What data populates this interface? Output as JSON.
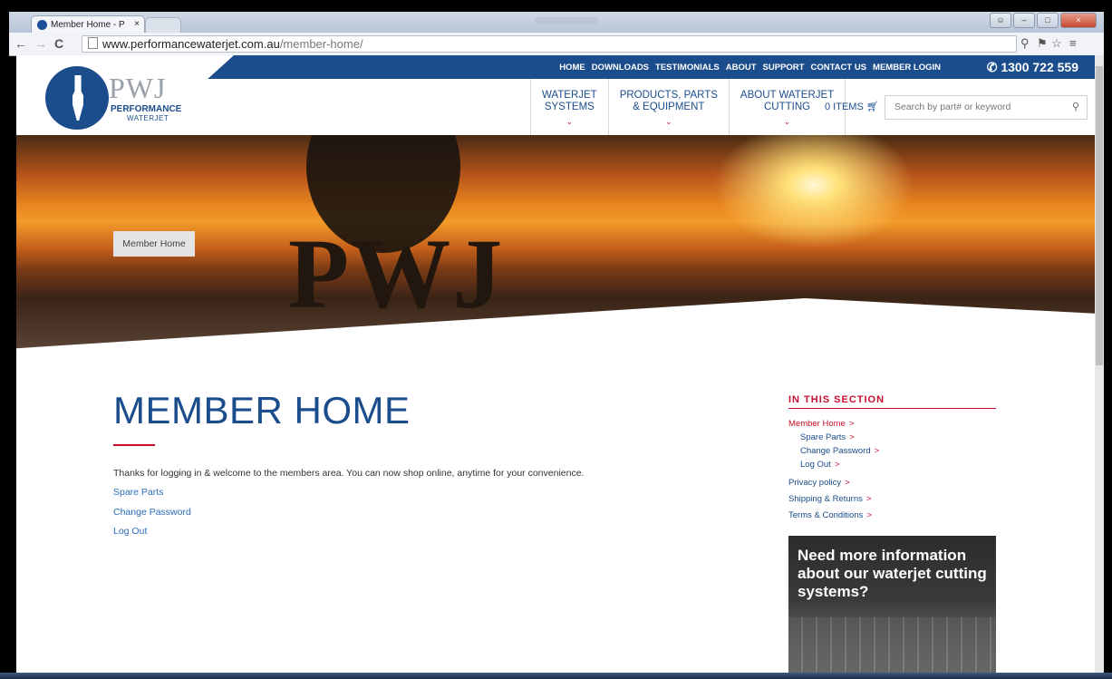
{
  "browser": {
    "tab_title": "Member Home - Perform",
    "tab_close": "×",
    "url_domain": "www.performancewaterjet.com.au",
    "url_path": "/member-home/"
  },
  "topbar": {
    "links": [
      "HOME",
      "DOWNLOADS",
      "TESTIMONIALS",
      "ABOUT",
      "SUPPORT",
      "CONTACT US",
      "MEMBER LOGIN"
    ],
    "phone": "1300 722 559"
  },
  "logo": {
    "mark": "PWJ",
    "line1": "PERFORMANCE",
    "line2": "WATERJET"
  },
  "nav": {
    "items": [
      {
        "line1": "WATERJET",
        "line2": "SYSTEMS"
      },
      {
        "line1": "PRODUCTS, PARTS",
        "line2": "& EQUIPMENT"
      },
      {
        "line1": "ABOUT WATERJET",
        "line2": "CUTTING"
      }
    ],
    "cart": "0 ITEMS",
    "search_placeholder": "Search by part# or keyword"
  },
  "hero": {
    "breadcrumb": "Member Home"
  },
  "main": {
    "title": "MEMBER HOME",
    "intro": "Thanks for logging in & welcome to the members area. You can now shop online, anytime for your convenience.",
    "links": [
      "Spare Parts",
      "Change Password",
      "Log Out"
    ]
  },
  "sidebar": {
    "title": "IN THIS SECTION",
    "active": "Member Home",
    "sub": [
      "Spare Parts",
      "Change Password",
      "Log Out"
    ],
    "items": [
      "Privacy policy",
      "Shipping & Returns",
      "Terms & Conditions"
    ],
    "arrow": ">"
  },
  "promo": {
    "text": "Need more information about our waterjet cutting systems?"
  },
  "colors": {
    "brand_blue": "#1b4d8c",
    "accent_red": "#c8102e",
    "link_blue": "#2a6cb5"
  }
}
